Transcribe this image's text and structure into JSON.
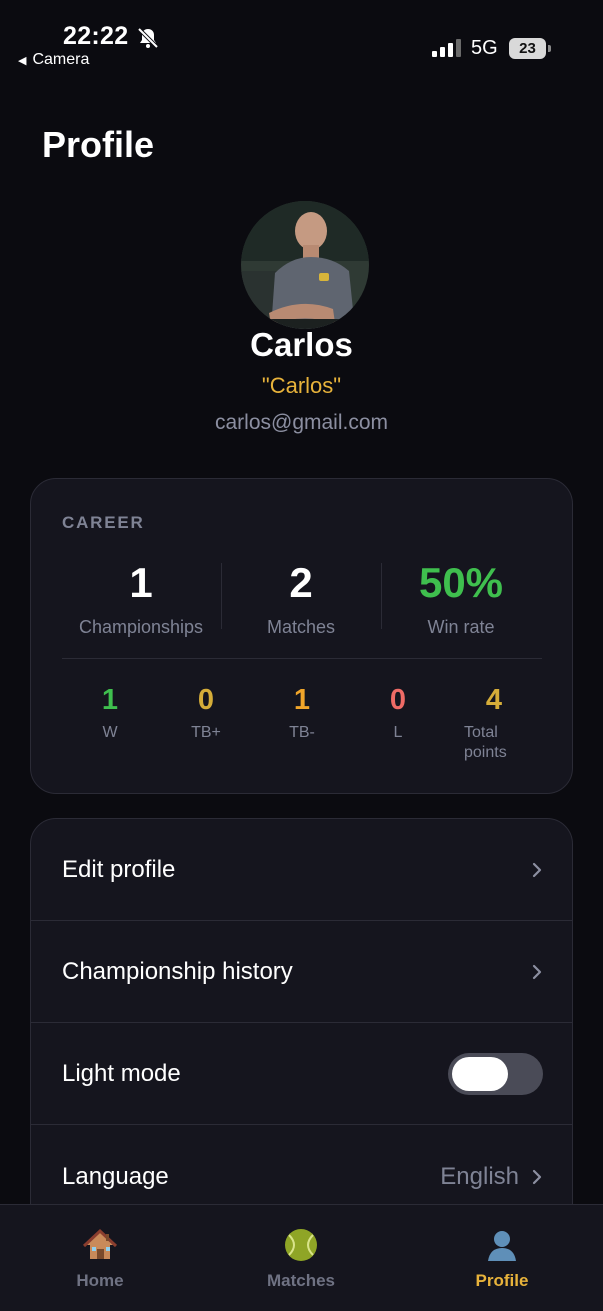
{
  "status_bar": {
    "time": "22:22",
    "back_app": "Camera",
    "network": "5G",
    "battery": "23"
  },
  "header": {
    "title": "Profile"
  },
  "profile": {
    "name": "Carlos",
    "nickname": "\"Carlos\"",
    "email": "carlos@gmail.com"
  },
  "career": {
    "heading": "CAREER",
    "stats": [
      {
        "value": "1",
        "label": "Championships"
      },
      {
        "value": "2",
        "label": "Matches"
      },
      {
        "value": "50%",
        "label": "Win rate"
      }
    ],
    "breakdown": [
      {
        "value": "1",
        "label": "W"
      },
      {
        "value": "0",
        "label": "TB+"
      },
      {
        "value": "1",
        "label": "TB-"
      },
      {
        "value": "0",
        "label": "L"
      },
      {
        "value": "4",
        "label": "Total points"
      }
    ]
  },
  "settings": {
    "edit_profile": "Edit profile",
    "championship_history": "Championship history",
    "light_mode": "Light mode",
    "light_mode_on": false,
    "language_label": "Language",
    "language_value": "English"
  },
  "tabs": [
    {
      "label": "Home",
      "icon": "house-icon"
    },
    {
      "label": "Matches",
      "icon": "tennis-ball-icon"
    },
    {
      "label": "Profile",
      "icon": "person-icon",
      "active": true
    }
  ],
  "colors": {
    "accent": "#e8b33b",
    "win_green": "#3fbf4e",
    "background": "#0b0b10",
    "card": "#15151e"
  }
}
